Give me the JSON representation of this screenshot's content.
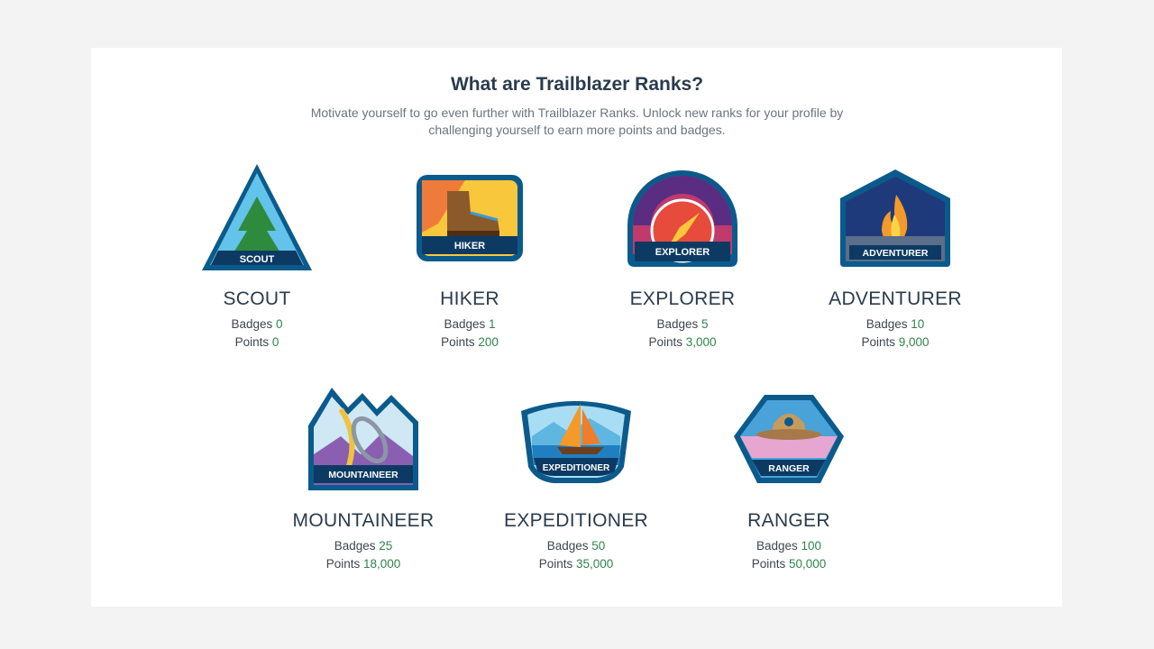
{
  "header": {
    "title": "What are Trailblazer Ranks?",
    "subtitle_line1": "Motivate yourself to go even further with Trailblazer Ranks. Unlock new ranks for your profile by",
    "subtitle_line2": "challenging yourself to earn more points and badges."
  },
  "stat_labels": {
    "badges": "Badges",
    "points": "Points"
  },
  "ranks": [
    {
      "name": "SCOUT",
      "badge_text": "SCOUT",
      "badges": "0",
      "points": "0",
      "icon": "scout-triangle-pine-tree-icon"
    },
    {
      "name": "HIKER",
      "badge_text": "HIKER",
      "badges": "1",
      "points": "200",
      "icon": "hiker-boot-icon"
    },
    {
      "name": "EXPLORER",
      "badge_text": "EXPLORER",
      "badges": "5",
      "points": "3,000",
      "icon": "explorer-compass-icon"
    },
    {
      "name": "ADVENTURER",
      "badge_text": "ADVENTURER",
      "badges": "10",
      "points": "9,000",
      "icon": "adventurer-campfire-icon"
    },
    {
      "name": "MOUNTAINEER",
      "badge_text": "MOUNTAINEER",
      "badges": "25",
      "points": "18,000",
      "icon": "mountaineer-carabiner-icon"
    },
    {
      "name": "EXPEDITIONER",
      "badge_text": "EXPEDITIONER",
      "badges": "50",
      "points": "35,000",
      "icon": "expeditioner-sailboat-icon"
    },
    {
      "name": "RANGER",
      "badge_text": "RANGER",
      "badges": "100",
      "points": "50,000",
      "icon": "ranger-hat-icon"
    }
  ],
  "colors": {
    "title": "#2a3b4d",
    "value_green": "#2e844a",
    "badge_border": "#0b5a8c",
    "badge_banner": "#0d3a63"
  }
}
